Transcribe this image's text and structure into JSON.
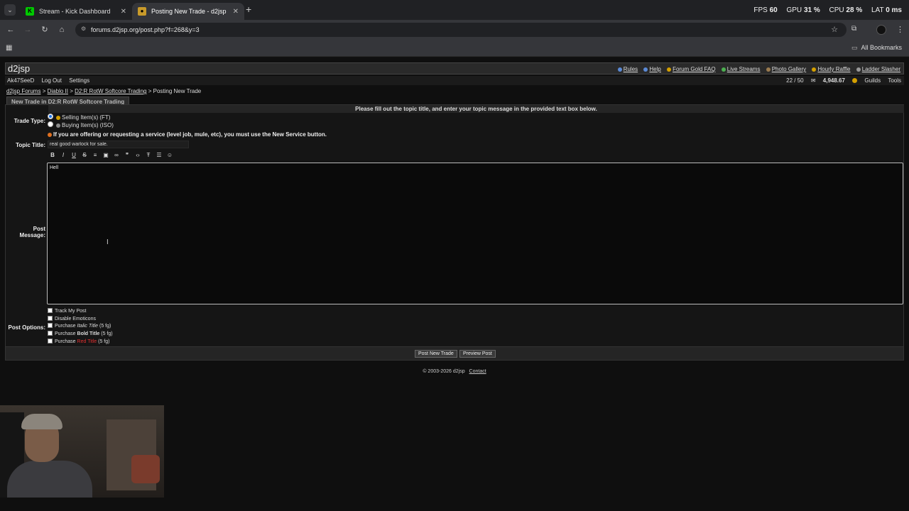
{
  "browser": {
    "tabs": [
      {
        "title": "Stream - Kick Dashboard",
        "favicon": "kick-icon",
        "active": false
      },
      {
        "title": "Posting New Trade - d2jsp",
        "favicon": "d2jsp-icon",
        "active": true
      }
    ],
    "url": "forums.d2jsp.org/post.php?f=268&y=3",
    "all_bookmarks": "All Bookmarks"
  },
  "perf_overlay": {
    "fps_label": "FPS",
    "fps": "60",
    "gpu_label": "GPU",
    "gpu": "31 %",
    "cpu_label": "CPU",
    "cpu": "28 %",
    "lat_label": "LAT",
    "lat": "0 ms"
  },
  "site": {
    "logo": "d2jsp",
    "top_links": [
      "Rules",
      "Help",
      "Forum Gold FAQ",
      "Live Streams",
      "Photo Gallery",
      "Hourly Raffle",
      "Ladder Slasher"
    ],
    "user": "Ak47SeeD",
    "logout": "Log Out",
    "settings": "Settings",
    "pm_count": "22 / 50",
    "gold": "4,948.67",
    "guilds": "Guilds",
    "tools": "Tools"
  },
  "breadcrumb": {
    "items": [
      "d2jsp Forums",
      "Diablo II",
      "D2:R RotW Softcore Trading"
    ],
    "current": "Posting New Trade",
    "sep": ">"
  },
  "form": {
    "legend": "New Trade in D2:R RotW Softcore Trading",
    "instructions": "Please fill out the topic title, and enter your topic message in the provided text box below.",
    "trade_type_label": "Trade Type:",
    "trade_types": [
      "Selling Item(s) (FT)",
      "Buying Item(s) (ISO)"
    ],
    "service_warning": "If you are offering or requesting a service (level job, mule, etc), you must use the New Service button.",
    "topic_title_label": "Topic Title:",
    "topic_title_value": "real good warlock for sale.",
    "post_message_label": "Post Message:",
    "message_value": "Hell",
    "post_options_label": "Post Options:",
    "options": {
      "track": "Track My Post",
      "disable_emoticons": "Disable Emoticons",
      "italic_prefix": "Purchase",
      "italic_word": "Italic Title",
      "italic_cost": "(5 fg)",
      "bold_prefix": "Purchase",
      "bold_word": "Bold Title",
      "bold_cost": "(5 fg)",
      "red_prefix": "Purchase",
      "red_word": "Red Title",
      "red_cost": "(5 fg)"
    },
    "submit": "Post New Trade",
    "preview": "Preview Post"
  },
  "footer": {
    "copyright": "© 2003-2026 d2jsp",
    "contact": "Contact"
  },
  "colors": {
    "accent_blue": "#1a73e8",
    "gold": "#d4a000",
    "red_title": "#e03030"
  }
}
